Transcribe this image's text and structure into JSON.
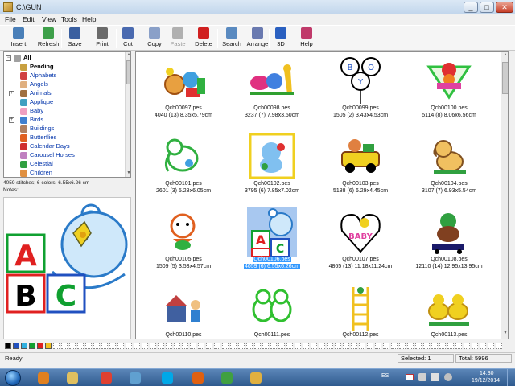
{
  "window": {
    "title": "C:\\GUN",
    "min": "_",
    "max": "□",
    "close": "✕"
  },
  "menu": [
    "File",
    "Edit",
    "View",
    "Tools",
    "Help"
  ],
  "toolbar": [
    {
      "label": "Insert",
      "icon": "insert-icon",
      "color": "#4a7fb8",
      "enabled": true
    },
    {
      "label": "Refresh",
      "icon": "refresh-icon",
      "color": "#3ea04a",
      "enabled": true
    },
    {
      "label": "Save",
      "icon": "save-icon",
      "color": "#3a5fa0",
      "enabled": true
    },
    {
      "label": "Print",
      "icon": "print-icon",
      "color": "#6a6a6a",
      "enabled": true
    },
    {
      "label": "Cut",
      "icon": "scissors-icon",
      "color": "#4a6ab0",
      "enabled": true
    },
    {
      "label": "Copy",
      "icon": "copy-icon",
      "color": "#8aa0c8",
      "enabled": true
    },
    {
      "label": "Paste",
      "icon": "paste-icon",
      "color": "#b0b0b0",
      "enabled": false
    },
    {
      "label": "Delete",
      "icon": "delete-icon",
      "color": "#d02020",
      "enabled": true
    },
    {
      "label": "Search",
      "icon": "search-icon",
      "color": "#5a8ac0",
      "enabled": true
    },
    {
      "label": "Arrange",
      "icon": "arrange-icon",
      "color": "#6a7ab0",
      "enabled": true
    },
    {
      "label": "3D",
      "icon": "3d-icon",
      "color": "#2a60c0",
      "enabled": true
    },
    {
      "label": "Help",
      "icon": "help-book-icon",
      "color": "#c03a6a",
      "enabled": true
    }
  ],
  "tree": [
    {
      "label": "All",
      "icon": "cd-icon",
      "color": "#a0a0a0",
      "level": 0,
      "bold": true,
      "expander": "−"
    },
    {
      "label": "Pending",
      "icon": "pending-icon",
      "color": "#c8a040",
      "level": 1,
      "bold": true,
      "expander": ""
    },
    {
      "label": "Alphabets",
      "icon": "alphabets-icon",
      "color": "#d04040",
      "level": 1,
      "bold": false,
      "expander": ""
    },
    {
      "label": "Angels",
      "icon": "angels-icon",
      "color": "#e0b080",
      "level": 1,
      "bold": false,
      "expander": ""
    },
    {
      "label": "Animals",
      "icon": "animals-icon",
      "color": "#a07040",
      "level": 1,
      "bold": false,
      "expander": "+"
    },
    {
      "label": "Applique",
      "icon": "applique-icon",
      "color": "#40a0c0",
      "level": 1,
      "bold": false,
      "expander": ""
    },
    {
      "label": "Baby",
      "icon": "baby-icon",
      "color": "#f0a0c0",
      "level": 1,
      "bold": false,
      "expander": ""
    },
    {
      "label": "Birds",
      "icon": "birds-icon",
      "color": "#4080d0",
      "level": 1,
      "bold": false,
      "expander": "+"
    },
    {
      "label": "Buildings",
      "icon": "buildings-icon",
      "color": "#b08060",
      "level": 1,
      "bold": false,
      "expander": ""
    },
    {
      "label": "Butterflies",
      "icon": "butterflies-icon",
      "color": "#e06020",
      "level": 1,
      "bold": false,
      "expander": ""
    },
    {
      "label": "Calendar Days",
      "icon": "calendar-icon",
      "color": "#d03030",
      "level": 1,
      "bold": false,
      "expander": ""
    },
    {
      "label": "Carousel Horses",
      "icon": "carousel-icon",
      "color": "#c080c0",
      "level": 1,
      "bold": false,
      "expander": ""
    },
    {
      "label": "Celestial",
      "icon": "celestial-icon",
      "color": "#30a040",
      "level": 1,
      "bold": false,
      "expander": ""
    },
    {
      "label": "Children",
      "icon": "children-icon",
      "color": "#e09040",
      "level": 1,
      "bold": false,
      "expander": ""
    }
  ],
  "info": {
    "stitches": "4059 stitches; 6 colors; 6.55x6.26 cm",
    "notes": "Notes:"
  },
  "thumbnails": [
    {
      "name": "Qch00097.pes",
      "info": "4040 (13) 8.35x5.79cm",
      "art": "toys",
      "selected": false
    },
    {
      "name": "Qch00098.pes",
      "info": "3237 (7) 7.98x3.50cm",
      "art": "animals-train",
      "selected": false
    },
    {
      "name": "Qch00099.pes",
      "info": "1505 (2) 3.43x4.53cm",
      "art": "boy-balloons",
      "selected": false
    },
    {
      "name": "Qch00100.pes",
      "info": "5114 (8) 8.06x6.56cm",
      "art": "baby-triangle",
      "selected": false
    },
    {
      "name": "Qch00101.pes",
      "info": "2601 (3) 5.28x6.05cm",
      "art": "elephant",
      "selected": false
    },
    {
      "name": "Qch00102.pes",
      "info": "3795 (6) 7.85x7.02cm",
      "art": "framed-bear",
      "selected": false
    },
    {
      "name": "Qch00103.pes",
      "info": "5188 (6) 6.29x4.45cm",
      "art": "toy-car",
      "selected": false
    },
    {
      "name": "Qch00104.pes",
      "info": "3107 (7) 6.93x5.54cm",
      "art": "puppy",
      "selected": false
    },
    {
      "name": "Qch00105.pes",
      "info": "1509 (5) 3.53x4.57cm",
      "art": "tiger",
      "selected": false
    },
    {
      "name": "Qch00106.pes",
      "info": "4059 (6) 6.55x6.26cm",
      "art": "abc-blocks",
      "selected": true
    },
    {
      "name": "Qch00107.pes",
      "info": "4865 (13) 11.18x11.24cm",
      "art": "baby-heart",
      "selected": false
    },
    {
      "name": "Qch00108.pes",
      "info": "12110 (14) 12.95x13.95cm",
      "art": "skater-dog",
      "selected": false
    },
    {
      "name": "Qch00110.pes",
      "info": "",
      "art": "house-kids",
      "selected": false
    },
    {
      "name": "Qch00111.pes",
      "info": "",
      "art": "dogs",
      "selected": false
    },
    {
      "name": "Qch00112.pes",
      "info": "",
      "art": "ladder",
      "selected": false
    },
    {
      "name": "Qch00113.pes",
      "info": "",
      "art": "ducks",
      "selected": false
    }
  ],
  "palette": [
    "#000000",
    "#2050c0",
    "#30b0e0",
    "#10a030",
    "#e02020",
    "#f0c020"
  ],
  "status": {
    "ready": "Ready",
    "selected": "Selected: 1",
    "total": "Total: 5996"
  },
  "taskbar": {
    "apps": [
      {
        "icon": "media-player-icon",
        "color": "#e08020"
      },
      {
        "icon": "folder-icon",
        "color": "#e0c060"
      },
      {
        "icon": "chrome-icon",
        "color": "#e04030"
      },
      {
        "icon": "monitor-icon",
        "color": "#60a0d0"
      },
      {
        "icon": "skype-icon",
        "color": "#00a8e8"
      },
      {
        "icon": "fire-icon",
        "color": "#e06010"
      },
      {
        "icon": "embroidery-app-icon",
        "color": "#40a040"
      },
      {
        "icon": "paint-icon",
        "color": "#e0b040"
      }
    ],
    "lang": "ES",
    "time": "14:30",
    "date": "19/12/2014"
  }
}
